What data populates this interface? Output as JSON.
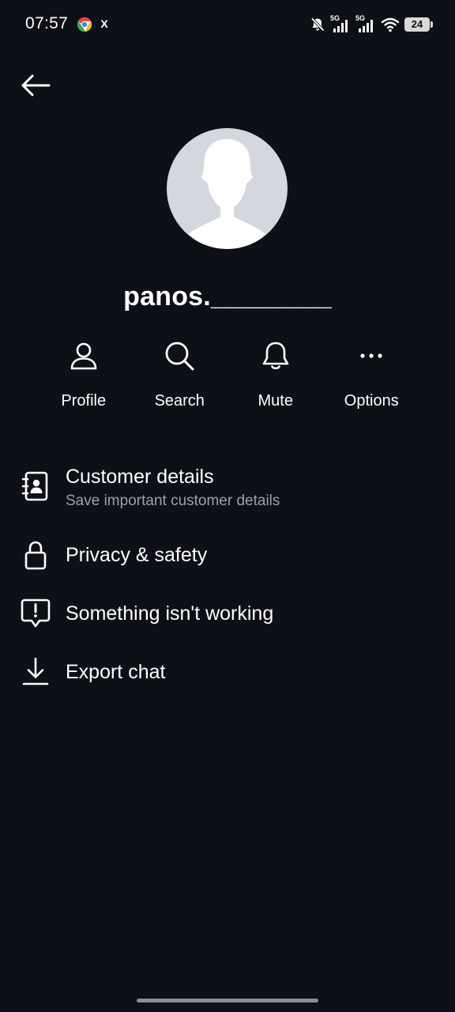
{
  "status_bar": {
    "time": "07:57",
    "notification_x": "X",
    "signal_1_label": "5G",
    "signal_2_label": "5G",
    "battery_level": "24"
  },
  "contact": {
    "name": "panos.________"
  },
  "actions": [
    {
      "label": "Profile",
      "icon": "person-icon"
    },
    {
      "label": "Search",
      "icon": "search-icon"
    },
    {
      "label": "Mute",
      "icon": "bell-icon"
    },
    {
      "label": "Options",
      "icon": "more-icon"
    }
  ],
  "menu": {
    "customer_details": {
      "title": "Customer details",
      "subtitle": "Save important customer details",
      "icon": "contact-book-icon"
    },
    "privacy": {
      "title": "Privacy & safety",
      "icon": "lock-icon"
    },
    "report": {
      "title": "Something isn't working",
      "icon": "report-icon"
    },
    "export": {
      "title": "Export chat",
      "icon": "download-icon"
    }
  },
  "colors": {
    "background": "#0d1117",
    "text": "#ffffff",
    "subtext": "#9aa0a8",
    "avatar_bg": "#d4d7dd"
  }
}
